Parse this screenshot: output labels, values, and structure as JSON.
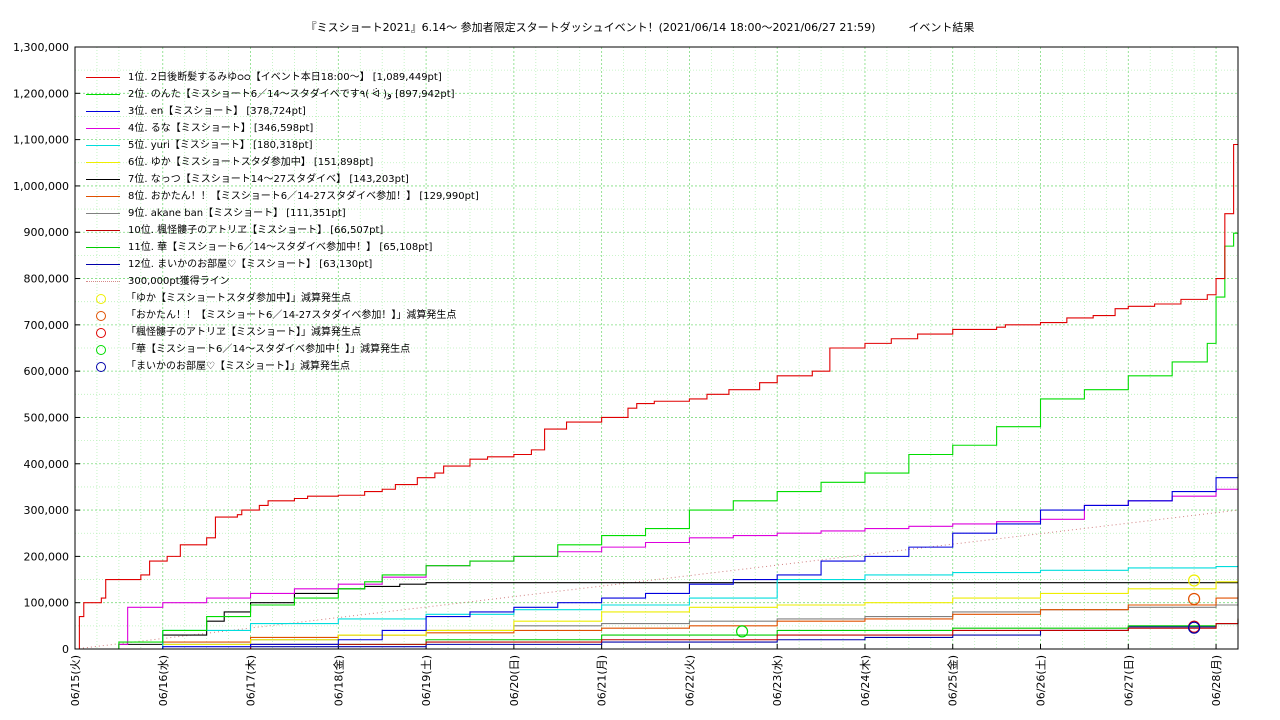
{
  "title": "『ミスショート2021』6.14～ 参加者限定スタートダッシュイベント！(2021/06/14 18:00～2021/06/27 21:59)　　　イベント結果",
  "chart_data": {
    "type": "line",
    "ylim": [
      0,
      1300000
    ],
    "yticks": [
      "0",
      "100,000",
      "200,000",
      "300,000",
      "400,000",
      "500,000",
      "600,000",
      "700,000",
      "800,000",
      "900,000",
      "1,000,000",
      "1,100,000",
      "1,200,000",
      "1,300,000"
    ],
    "xticks": [
      "06/15(火)",
      "06/16(水)",
      "06/17(木)",
      "06/18(金)",
      "06/19(土)",
      "06/20(日)",
      "06/21(月)",
      "06/22(火)",
      "06/23(水)",
      "06/24(木)",
      "06/25(金)",
      "06/26(土)",
      "06/27(日)",
      "06/28(月)"
    ],
    "x_range_days": [
      0,
      13.25
    ],
    "grid": true,
    "legend_position": "top-left",
    "series": [
      {
        "name": "1位. 2日後断髪するみゆᴑᴑ【イベント本日18:00〜】 [1,089,449pt]",
        "color": "#e00000",
        "x": [
          0,
          0.05,
          0.1,
          0.3,
          0.35,
          0.75,
          0.85,
          1.05,
          1.2,
          1.5,
          1.6,
          1.85,
          1.9,
          2.1,
          2.2,
          2.5,
          2.65,
          3.0,
          3.3,
          3.5,
          3.65,
          3.9,
          4.1,
          4.2,
          4.5,
          4.7,
          5.0,
          5.2,
          5.35,
          5.6,
          6.0,
          6.3,
          6.4,
          6.6,
          7.0,
          7.2,
          7.45,
          7.8,
          8.0,
          8.4,
          8.6,
          9.0,
          9.3,
          9.6,
          10.0,
          10.5,
          10.6,
          11.0,
          11.3,
          11.6,
          11.85,
          12.0,
          12.3,
          12.6,
          12.9,
          13.0,
          13.1,
          13.2,
          13.25
        ],
        "y": [
          0,
          70000,
          100000,
          110000,
          150000,
          160000,
          190000,
          200000,
          225000,
          240000,
          285000,
          290000,
          300000,
          310000,
          320000,
          325000,
          330000,
          332000,
          340000,
          345000,
          355000,
          370000,
          380000,
          395000,
          410000,
          415000,
          420000,
          430000,
          475000,
          490000,
          500000,
          520000,
          530000,
          535000,
          540000,
          550000,
          560000,
          575000,
          590000,
          600000,
          650000,
          660000,
          670000,
          680000,
          690000,
          695000,
          700000,
          705000,
          715000,
          720000,
          735000,
          740000,
          745000,
          755000,
          765000,
          800000,
          940000,
          1089449,
          1089449
        ]
      },
      {
        "name": "2位. のんた【ミスショート6／14〜スタダイベです٩( ᐛ )و [897,942pt]",
        "color": "#00dd00",
        "x": [
          0,
          0.5,
          1.0,
          1.5,
          2.0,
          2.5,
          3.0,
          3.3,
          3.5,
          4.0,
          4.5,
          5.0,
          5.5,
          6.0,
          6.5,
          7.0,
          7.5,
          8.0,
          8.5,
          9.0,
          9.5,
          10.0,
          10.5,
          11.0,
          11.5,
          12.0,
          12.5,
          12.9,
          13.0,
          13.1,
          13.2,
          13.25
        ],
        "y": [
          0,
          15000,
          40000,
          70000,
          95000,
          110000,
          130000,
          145000,
          160000,
          180000,
          190000,
          200000,
          225000,
          245000,
          260000,
          300000,
          320000,
          340000,
          360000,
          380000,
          420000,
          440000,
          480000,
          540000,
          560000,
          590000,
          620000,
          660000,
          760000,
          870000,
          897942,
          897942
        ]
      },
      {
        "name": "3位. en【ミスショート】 [378,724pt]",
        "color": "#0000dd",
        "x": [
          0,
          1.0,
          2.0,
          3.0,
          3.5,
          4.0,
          4.5,
          5.0,
          5.5,
          6.0,
          6.5,
          7.0,
          7.5,
          8.0,
          8.5,
          9.0,
          9.5,
          10.0,
          10.5,
          11.0,
          11.5,
          12.0,
          12.5,
          13.0,
          13.25
        ],
        "y": [
          0,
          5000,
          10000,
          20000,
          40000,
          70000,
          80000,
          90000,
          100000,
          110000,
          120000,
          140000,
          150000,
          160000,
          190000,
          200000,
          220000,
          250000,
          270000,
          300000,
          310000,
          320000,
          340000,
          370000,
          378724
        ]
      },
      {
        "name": "4位. るな【ミスショート】 [346,598pt]",
        "color": "#dd00dd",
        "x": [
          0,
          0.5,
          0.6,
          1.0,
          1.5,
          2.0,
          2.5,
          3.0,
          3.5,
          4.0,
          4.5,
          5.0,
          5.5,
          6.0,
          6.5,
          7.0,
          7.5,
          8.0,
          8.5,
          9.0,
          9.5,
          10.0,
          10.5,
          11.0,
          11.5,
          12.0,
          12.5,
          13.0,
          13.25
        ],
        "y": [
          0,
          10000,
          90000,
          100000,
          110000,
          120000,
          130000,
          140000,
          155000,
          180000,
          190000,
          200000,
          210000,
          220000,
          230000,
          240000,
          245000,
          250000,
          255000,
          260000,
          265000,
          270000,
          275000,
          280000,
          310000,
          320000,
          330000,
          345000,
          346598
        ]
      },
      {
        "name": "5位. yuri【ミスショート】 [180,318pt]",
        "color": "#00dddd",
        "x": [
          0,
          1.0,
          2.0,
          3.0,
          4.0,
          5.0,
          6.0,
          7.0,
          8.0,
          9.0,
          10.0,
          11.0,
          12.0,
          13.0,
          13.25
        ],
        "y": [
          0,
          40000,
          55000,
          65000,
          75000,
          85000,
          95000,
          110000,
          150000,
          160000,
          165000,
          170000,
          175000,
          178000,
          180318
        ]
      },
      {
        "name": "6位. ゆか【ミスショートスタダ参加中】 [151,898pt]",
        "color": "#eeee00",
        "x": [
          0,
          1.0,
          2.0,
          3.0,
          4.0,
          5.0,
          6.0,
          7.0,
          8.0,
          9.0,
          10.0,
          11.0,
          12.0,
          13.0,
          13.25
        ],
        "y": [
          0,
          10000,
          20000,
          30000,
          40000,
          60000,
          80000,
          90000,
          95000,
          100000,
          110000,
          120000,
          130000,
          145000,
          151898
        ]
      },
      {
        "name": "7位. なっつ【ミスショート14〜27スタダイベ】 [143,203pt]",
        "color": "#000000",
        "x": [
          0,
          0.5,
          1.0,
          1.5,
          1.7,
          2.0,
          2.5,
          3.0,
          3.3,
          3.7,
          4.0,
          13.25
        ],
        "y": [
          0,
          10000,
          30000,
          60000,
          80000,
          100000,
          120000,
          130000,
          135000,
          140000,
          143203,
          143203
        ]
      },
      {
        "name": "8位. おかたん！！【ミスショート6／14-27スタダイベ参加！】 [129,990pt]",
        "color": "#e05000",
        "x": [
          0,
          1.0,
          2.0,
          3.0,
          4.0,
          5.0,
          6.0,
          7.0,
          8.0,
          9.0,
          10.0,
          11.0,
          12.0,
          13.0,
          13.25
        ],
        "y": [
          0,
          15000,
          25000,
          30000,
          35000,
          40000,
          45000,
          50000,
          60000,
          65000,
          75000,
          85000,
          95000,
          110000,
          129990
        ]
      },
      {
        "name": "9位. akane ban【ミスショート】 [111,351pt]",
        "color": "#808080",
        "x": [
          0,
          1.0,
          2.0,
          3.0,
          4.0,
          5.0,
          6.0,
          7.0,
          8.0,
          9.0,
          10.0,
          11.0,
          12.0,
          13.0,
          13.25
        ],
        "y": [
          0,
          10000,
          20000,
          30000,
          40000,
          50000,
          55000,
          60000,
          65000,
          70000,
          80000,
          85000,
          90000,
          95000,
          111351
        ]
      },
      {
        "name": "10位. 楓怪髏子のアトリヱ【ミスショート】 [66,507pt]",
        "color": "#c00000",
        "x": [
          0,
          2.0,
          4.0,
          6.0,
          8.0,
          10.0,
          12.0,
          13.0,
          13.25
        ],
        "y": [
          0,
          10000,
          15000,
          20000,
          30000,
          40000,
          45000,
          55000,
          66507
        ]
      },
      {
        "name": "11位. 華【ミスショート6／14〜スタダイベ参加中！】 [65,108pt]",
        "color": "#00cc00",
        "x": [
          0,
          2.0,
          4.0,
          6.0,
          8.0,
          10.0,
          12.0,
          13.0,
          13.25
        ],
        "y": [
          0,
          10000,
          20000,
          30000,
          40000,
          45000,
          50000,
          55000,
          65108
        ]
      },
      {
        "name": "12位. まいかのお部屋♡【ミスショート】 [63,130pt]",
        "color": "#0000aa",
        "x": [
          0,
          2.0,
          4.0,
          6.0,
          8.0,
          9.0,
          10.0,
          11.0,
          12.0,
          13.0,
          13.25
        ],
        "y": [
          0,
          5000,
          10000,
          15000,
          20000,
          25000,
          30000,
          40000,
          48000,
          55000,
          63130
        ]
      }
    ],
    "reference_line": {
      "label": "300,000pt獲得ライン",
      "color": "#d08080",
      "x": [
        0,
        13.25
      ],
      "y": [
        0,
        300000
      ]
    },
    "markers": [
      {
        "label": "「ゆか【ミスショートスタダ参加中】」減算発生点",
        "color": "#eeee00",
        "x": 12.75,
        "y": 148000
      },
      {
        "label": "「おかたん！！【ミスショート6／14-27スタダイベ参加！】」減算発生点",
        "color": "#e05000",
        "x": 12.75,
        "y": 108000
      },
      {
        "label": "「楓怪髏子のアトリヱ【ミスショート】」減算発生点",
        "color": "#e00000",
        "x": 12.75,
        "y": 48000
      },
      {
        "label": "「華【ミスショート6／14〜スタダイベ参加中！】」減算発生点",
        "color": "#00dd00",
        "x": 7.6,
        "y": 38000
      },
      {
        "label": "「まいかのお部屋♡【ミスショート】」減算発生点",
        "color": "#0000aa",
        "x": 12.75,
        "y": 46000
      }
    ]
  }
}
